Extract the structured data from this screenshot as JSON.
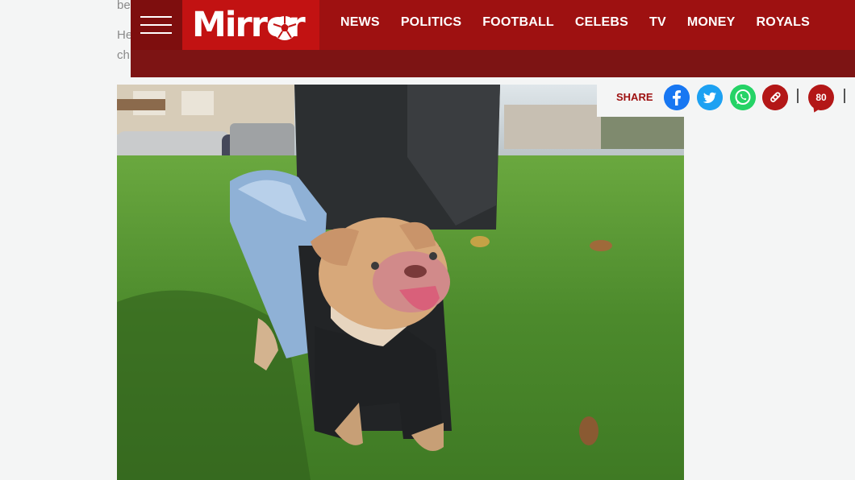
{
  "article": {
    "snippet_lines": [
      "be",
      "He",
      "ch"
    ],
    "photo": {
      "alt": ""
    }
  },
  "header": {
    "logo_text": "Mirror",
    "nav": [
      "NEWS",
      "POLITICS",
      "FOOTBALL",
      "CELEBS",
      "TV",
      "MONEY",
      "ROYALS"
    ],
    "colors": {
      "bar": "#9e1111",
      "logo_bg": "#c21212",
      "menu_bg": "#7e0e0e",
      "lower_bar": "#7d1414"
    }
  },
  "share": {
    "label": "SHARE",
    "icons": [
      "facebook-icon",
      "twitter-icon",
      "whatsapp-icon",
      "link-icon"
    ],
    "comment_count": "80"
  }
}
